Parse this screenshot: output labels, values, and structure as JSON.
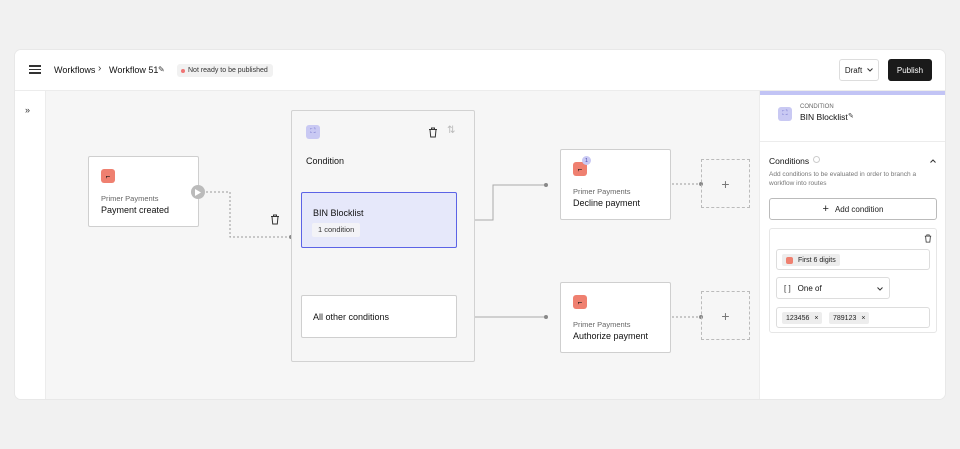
{
  "header": {
    "breadcrumb_root": "Workflows",
    "workflow_name": "Workflow 51",
    "status_badge": "Not ready to be published",
    "draft_label": "Draft",
    "publish_label": "Publish"
  },
  "canvas": {
    "trigger": {
      "app": "Primer Payments",
      "title": "Payment created"
    },
    "condition_group": {
      "title": "Condition",
      "route_main": {
        "title": "BIN Blocklist",
        "badge": "1 condition"
      },
      "route_other": {
        "title": "All other conditions"
      }
    },
    "decline_node": {
      "app": "Primer Payments",
      "title": "Decline payment",
      "notification_count": "1"
    },
    "authorize_node": {
      "app": "Primer Payments",
      "title": "Authorize payment"
    },
    "add_step_symbol": "+"
  },
  "panel": {
    "kind_label": "CONDITION",
    "title": "BIN Blocklist",
    "section_title": "Conditions",
    "section_help": "Add conditions to be evaluated in order to branch a workflow into routes",
    "add_condition_label": "Add condition",
    "condition": {
      "field_label": "First 6 digits",
      "operator": "One of",
      "values": [
        "123456",
        "789123"
      ]
    }
  },
  "colors": {
    "accent": "#5c63e6",
    "accent_bg": "#e6e8fa",
    "app_icon": "#ef8070",
    "publish_bg": "#1a1a1a",
    "status_dot": "#f07474"
  }
}
